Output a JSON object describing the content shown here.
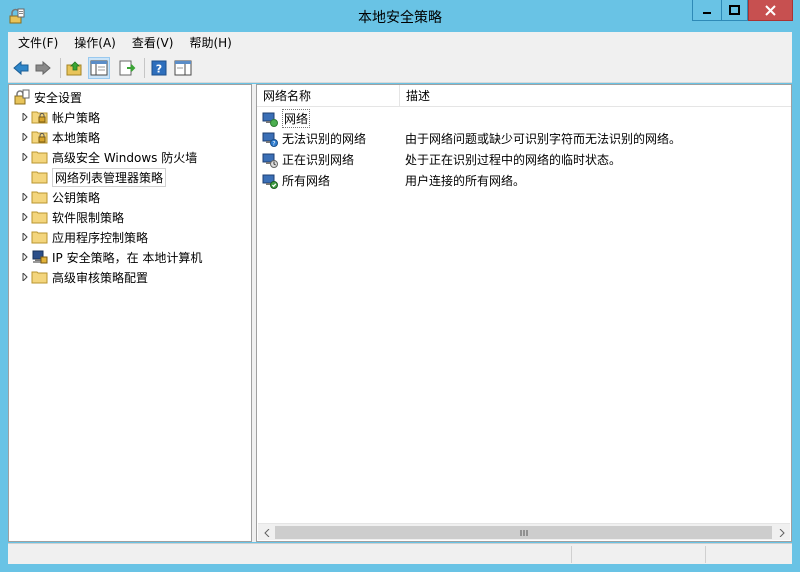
{
  "window": {
    "title": "本地安全策略",
    "buttons": {
      "minimize": "—",
      "maximize": "□",
      "close": "✕"
    }
  },
  "menu": [
    {
      "label": "文件(F)"
    },
    {
      "label": "操作(A)"
    },
    {
      "label": "查看(V)"
    },
    {
      "label": "帮助(H)"
    }
  ],
  "toolbar": [
    "back-icon",
    "forward-icon",
    "up-folder-icon",
    "show-hide-tree-icon",
    "export-list-icon",
    "help-icon",
    "action-pane-icon"
  ],
  "tree": {
    "root": "安全设置",
    "items": [
      {
        "label": "帐户策略",
        "icon": "folder-lock-icon",
        "expandable": true
      },
      {
        "label": "本地策略",
        "icon": "folder-lock-icon",
        "expandable": true
      },
      {
        "label": "高级安全 Windows 防火墙",
        "icon": "folder-icon",
        "expandable": true
      },
      {
        "label": "网络列表管理器策略",
        "icon": "folder-icon",
        "expandable": false,
        "selected": true
      },
      {
        "label": "公钥策略",
        "icon": "folder-icon",
        "expandable": true
      },
      {
        "label": "软件限制策略",
        "icon": "folder-icon",
        "expandable": true
      },
      {
        "label": "应用程序控制策略",
        "icon": "folder-icon",
        "expandable": true
      },
      {
        "label": "IP 安全策略，在 本地计算机",
        "icon": "ip-security-icon",
        "expandable": true
      },
      {
        "label": "高级审核策略配置",
        "icon": "folder-icon",
        "expandable": true
      }
    ]
  },
  "list": {
    "columns": [
      "网络名称",
      "描述"
    ],
    "rows": [
      {
        "name": "网络",
        "desc": ""
      },
      {
        "name": "无法识别的网络",
        "desc": "由于网络问题或缺少可识别字符而无法识别的网络。"
      },
      {
        "name": "正在识别网络",
        "desc": "处于正在识别过程中的网络的临时状态。"
      },
      {
        "name": "所有网络",
        "desc": "用户连接的所有网络。"
      }
    ]
  },
  "colors": {
    "titlebar": "#69c3e5",
    "close": "#c75050",
    "pressed": "#cce4f7"
  }
}
